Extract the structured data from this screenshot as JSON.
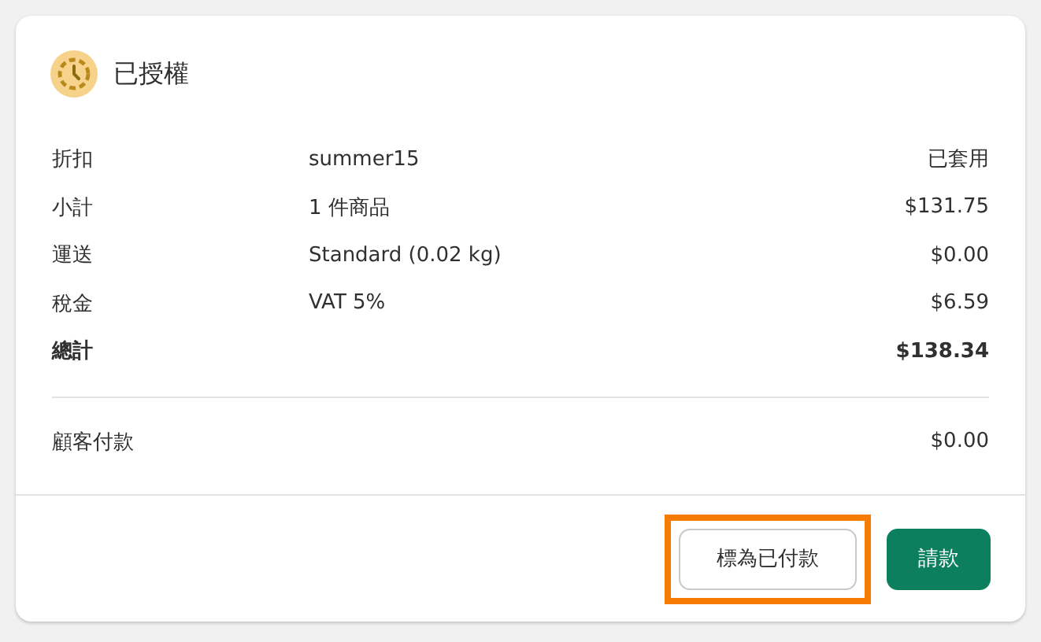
{
  "header": {
    "title": "已授權"
  },
  "rows": [
    {
      "label": "折扣",
      "detail": "summer15",
      "value": "已套用",
      "bold": false
    },
    {
      "label": "小計",
      "detail": "1 件商品",
      "value": "$131.75",
      "bold": false
    },
    {
      "label": "運送",
      "detail": "Standard (0.02 kg)",
      "value": "$0.00",
      "bold": false
    },
    {
      "label": "稅金",
      "detail": "VAT 5%",
      "value": "$6.59",
      "bold": false
    },
    {
      "label": "總計",
      "value": "$138.34",
      "bold": true
    }
  ],
  "paid": {
    "label": "顧客付款",
    "value": "$0.00"
  },
  "buttons": [
    {
      "label": "標為已付款",
      "kind": "secondary",
      "highlighted": true
    },
    {
      "label": "請款",
      "kind": "primary",
      "highlighted": false
    }
  ]
}
